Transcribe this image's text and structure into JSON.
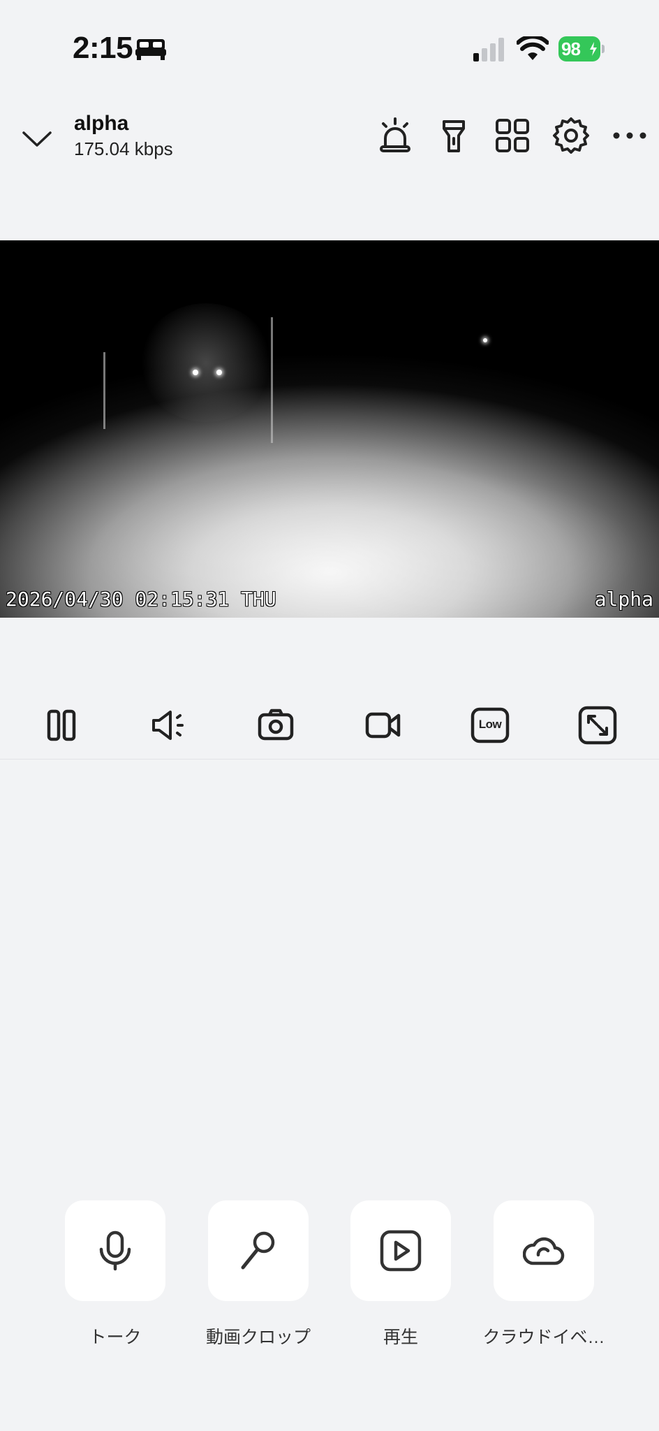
{
  "status_bar": {
    "time": "2:15",
    "battery_percent": "98",
    "icons": [
      "bed-icon",
      "signal-icon",
      "wifi-icon",
      "battery-icon"
    ]
  },
  "header": {
    "device_name": "alpha",
    "bitrate": "175.04 kbps",
    "icons": [
      "chevron-down-icon",
      "siren-icon",
      "flashlight-icon",
      "grid-icon",
      "gear-icon",
      "more-icon"
    ]
  },
  "video": {
    "timestamp": "2026/04/30 02:15:31 THU",
    "camera_label": "alpha"
  },
  "controls": {
    "items": [
      "pause-icon",
      "speaker-icon",
      "camera-icon",
      "video-record-icon",
      "quality-low-icon",
      "fullscreen-icon"
    ],
    "quality_label": "Low"
  },
  "actions": [
    {
      "label": "トーク",
      "icon": "microphone-icon"
    },
    {
      "label": "動画クロップ",
      "icon": "magnifier-icon"
    },
    {
      "label": "再生",
      "icon": "play-icon"
    },
    {
      "label": "クラウドイベ…",
      "icon": "cloud-icon"
    }
  ]
}
